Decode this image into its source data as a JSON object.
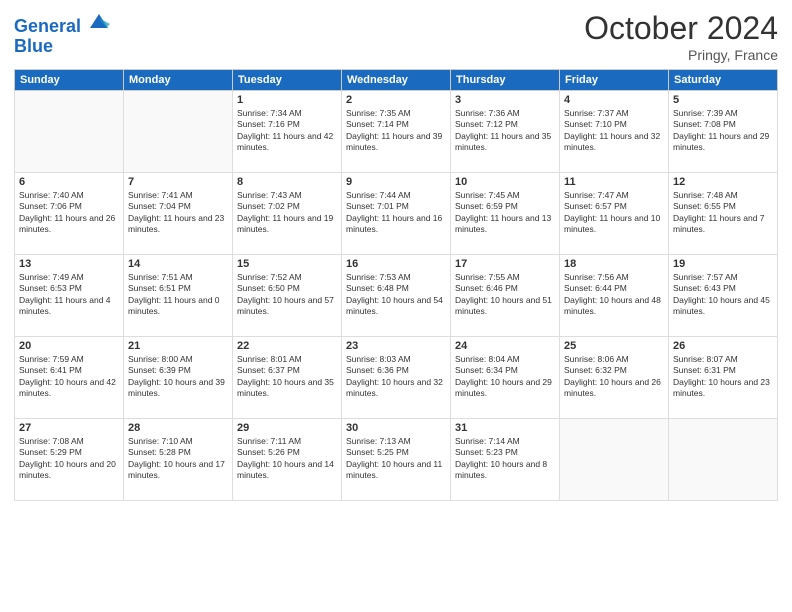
{
  "header": {
    "logo_line1": "General",
    "logo_line2": "Blue",
    "month": "October 2024",
    "location": "Pringy, France"
  },
  "weekdays": [
    "Sunday",
    "Monday",
    "Tuesday",
    "Wednesday",
    "Thursday",
    "Friday",
    "Saturday"
  ],
  "weeks": [
    [
      {
        "day": "",
        "info": ""
      },
      {
        "day": "",
        "info": ""
      },
      {
        "day": "1",
        "info": "Sunrise: 7:34 AM\nSunset: 7:16 PM\nDaylight: 11 hours and 42 minutes."
      },
      {
        "day": "2",
        "info": "Sunrise: 7:35 AM\nSunset: 7:14 PM\nDaylight: 11 hours and 39 minutes."
      },
      {
        "day": "3",
        "info": "Sunrise: 7:36 AM\nSunset: 7:12 PM\nDaylight: 11 hours and 35 minutes."
      },
      {
        "day": "4",
        "info": "Sunrise: 7:37 AM\nSunset: 7:10 PM\nDaylight: 11 hours and 32 minutes."
      },
      {
        "day": "5",
        "info": "Sunrise: 7:39 AM\nSunset: 7:08 PM\nDaylight: 11 hours and 29 minutes."
      }
    ],
    [
      {
        "day": "6",
        "info": "Sunrise: 7:40 AM\nSunset: 7:06 PM\nDaylight: 11 hours and 26 minutes."
      },
      {
        "day": "7",
        "info": "Sunrise: 7:41 AM\nSunset: 7:04 PM\nDaylight: 11 hours and 23 minutes."
      },
      {
        "day": "8",
        "info": "Sunrise: 7:43 AM\nSunset: 7:02 PM\nDaylight: 11 hours and 19 minutes."
      },
      {
        "day": "9",
        "info": "Sunrise: 7:44 AM\nSunset: 7:01 PM\nDaylight: 11 hours and 16 minutes."
      },
      {
        "day": "10",
        "info": "Sunrise: 7:45 AM\nSunset: 6:59 PM\nDaylight: 11 hours and 13 minutes."
      },
      {
        "day": "11",
        "info": "Sunrise: 7:47 AM\nSunset: 6:57 PM\nDaylight: 11 hours and 10 minutes."
      },
      {
        "day": "12",
        "info": "Sunrise: 7:48 AM\nSunset: 6:55 PM\nDaylight: 11 hours and 7 minutes."
      }
    ],
    [
      {
        "day": "13",
        "info": "Sunrise: 7:49 AM\nSunset: 6:53 PM\nDaylight: 11 hours and 4 minutes."
      },
      {
        "day": "14",
        "info": "Sunrise: 7:51 AM\nSunset: 6:51 PM\nDaylight: 11 hours and 0 minutes."
      },
      {
        "day": "15",
        "info": "Sunrise: 7:52 AM\nSunset: 6:50 PM\nDaylight: 10 hours and 57 minutes."
      },
      {
        "day": "16",
        "info": "Sunrise: 7:53 AM\nSunset: 6:48 PM\nDaylight: 10 hours and 54 minutes."
      },
      {
        "day": "17",
        "info": "Sunrise: 7:55 AM\nSunset: 6:46 PM\nDaylight: 10 hours and 51 minutes."
      },
      {
        "day": "18",
        "info": "Sunrise: 7:56 AM\nSunset: 6:44 PM\nDaylight: 10 hours and 48 minutes."
      },
      {
        "day": "19",
        "info": "Sunrise: 7:57 AM\nSunset: 6:43 PM\nDaylight: 10 hours and 45 minutes."
      }
    ],
    [
      {
        "day": "20",
        "info": "Sunrise: 7:59 AM\nSunset: 6:41 PM\nDaylight: 10 hours and 42 minutes."
      },
      {
        "day": "21",
        "info": "Sunrise: 8:00 AM\nSunset: 6:39 PM\nDaylight: 10 hours and 39 minutes."
      },
      {
        "day": "22",
        "info": "Sunrise: 8:01 AM\nSunset: 6:37 PM\nDaylight: 10 hours and 35 minutes."
      },
      {
        "day": "23",
        "info": "Sunrise: 8:03 AM\nSunset: 6:36 PM\nDaylight: 10 hours and 32 minutes."
      },
      {
        "day": "24",
        "info": "Sunrise: 8:04 AM\nSunset: 6:34 PM\nDaylight: 10 hours and 29 minutes."
      },
      {
        "day": "25",
        "info": "Sunrise: 8:06 AM\nSunset: 6:32 PM\nDaylight: 10 hours and 26 minutes."
      },
      {
        "day": "26",
        "info": "Sunrise: 8:07 AM\nSunset: 6:31 PM\nDaylight: 10 hours and 23 minutes."
      }
    ],
    [
      {
        "day": "27",
        "info": "Sunrise: 7:08 AM\nSunset: 5:29 PM\nDaylight: 10 hours and 20 minutes."
      },
      {
        "day": "28",
        "info": "Sunrise: 7:10 AM\nSunset: 5:28 PM\nDaylight: 10 hours and 17 minutes."
      },
      {
        "day": "29",
        "info": "Sunrise: 7:11 AM\nSunset: 5:26 PM\nDaylight: 10 hours and 14 minutes."
      },
      {
        "day": "30",
        "info": "Sunrise: 7:13 AM\nSunset: 5:25 PM\nDaylight: 10 hours and 11 minutes."
      },
      {
        "day": "31",
        "info": "Sunrise: 7:14 AM\nSunset: 5:23 PM\nDaylight: 10 hours and 8 minutes."
      },
      {
        "day": "",
        "info": ""
      },
      {
        "day": "",
        "info": ""
      }
    ]
  ]
}
